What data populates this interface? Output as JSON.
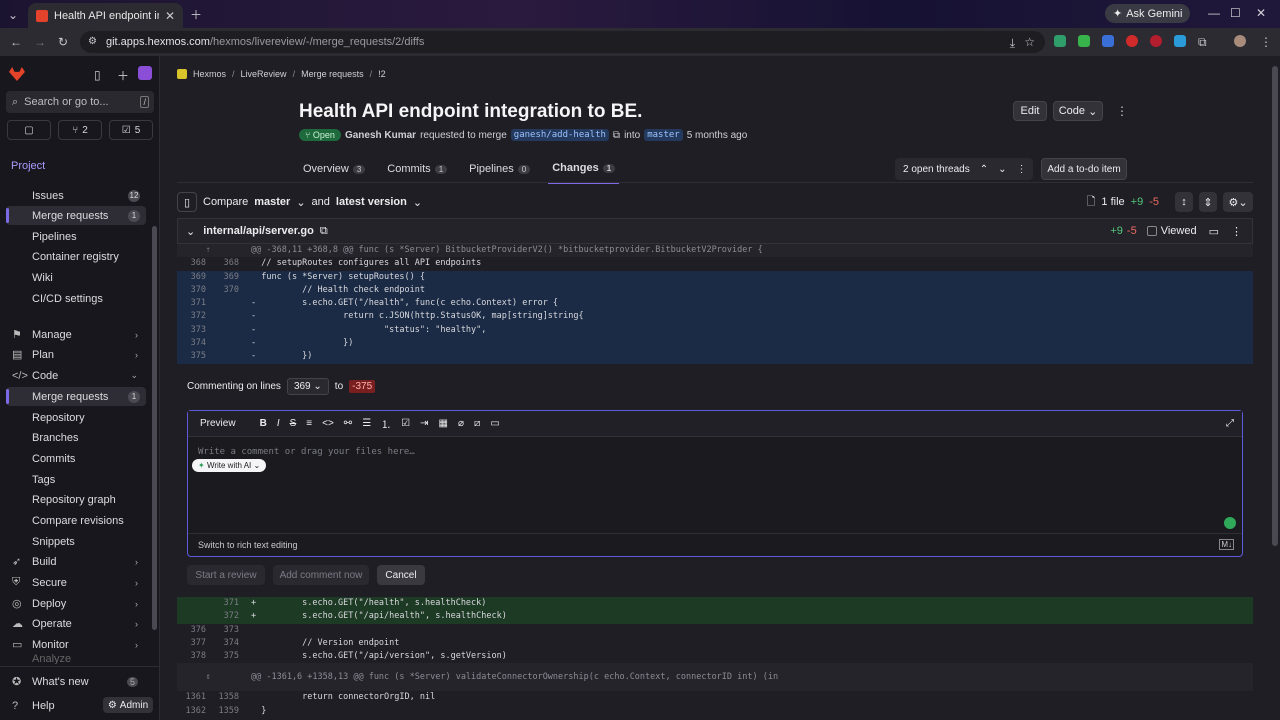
{
  "browser": {
    "tab_title": "Health API endpoint integratio",
    "url_host": "git.apps.hexmos.com",
    "url_path": "/hexmos/livereview/-/merge_requests/2/diffs",
    "gemini_label": "Ask Gemini"
  },
  "sidebar": {
    "search_placeholder": "Search or go to...",
    "counters": [
      "2",
      "5"
    ],
    "project_label": "Project",
    "top_items": [
      {
        "label": "Issues",
        "badge": "12"
      },
      {
        "label": "Merge requests",
        "badge": "1"
      },
      {
        "label": "Pipelines"
      },
      {
        "label": "Container registry"
      },
      {
        "label": "Wiki"
      },
      {
        "label": "CI/CD settings"
      }
    ],
    "groups": [
      "Manage",
      "Plan",
      "Code"
    ],
    "code_items": [
      {
        "label": "Merge requests",
        "badge": "1"
      },
      {
        "label": "Repository"
      },
      {
        "label": "Branches"
      },
      {
        "label": "Commits"
      },
      {
        "label": "Tags"
      },
      {
        "label": "Repository graph"
      },
      {
        "label": "Compare revisions"
      },
      {
        "label": "Snippets"
      }
    ],
    "groups2": [
      "Build",
      "Secure",
      "Deploy",
      "Operate",
      "Monitor"
    ],
    "analyze": "Analyze",
    "whats_new": "What's new",
    "whats_new_count": "5",
    "help": "Help",
    "admin": "Admin"
  },
  "breadcrumb": [
    "Hexmos",
    "LiveReview",
    "Merge requests",
    "!2"
  ],
  "mr": {
    "title": "Health API endpoint integration to BE.",
    "status": "Open",
    "author": "Ganesh Kumar",
    "requested": "requested to merge",
    "source_branch": "ganesh/add-health",
    "into": "into",
    "target_branch": "master",
    "time": "5 months ago",
    "edit": "Edit",
    "code": "Code"
  },
  "tabs": [
    {
      "label": "Overview",
      "count": "3"
    },
    {
      "label": "Commits",
      "count": "1"
    },
    {
      "label": "Pipelines",
      "count": "0"
    },
    {
      "label": "Changes",
      "count": "1"
    }
  ],
  "threads": {
    "label": "2 open threads",
    "todo": "Add a to-do item"
  },
  "compare": {
    "label": "Compare",
    "base": "master",
    "and": "and",
    "version": "latest version",
    "files": "1 file",
    "added": "+9",
    "removed": "-5"
  },
  "file": {
    "path": "internal/api/server.go",
    "added": "+9",
    "removed": "-5",
    "viewed": "Viewed"
  },
  "diff": {
    "hunk1": "@@ -368,11 +368,8 @@ func (s *Server) BitbucketProviderV2() *bitbucketprovider.BitbucketV2Provider {",
    "lines_top": [
      {
        "old": "368",
        "new": "368",
        "text": "  // setupRoutes configures all API endpoints",
        "type": "plain"
      },
      {
        "old": "369",
        "new": "369",
        "text": "  func (s *Server) setupRoutes() {",
        "type": "sel"
      },
      {
        "old": "370",
        "new": "370",
        "text": "          // Health check endpoint",
        "type": "sel"
      },
      {
        "old": "371",
        "new": "",
        "text": "-         s.echo.GET(\"/health\", func(c echo.Context) error {",
        "type": "sel"
      },
      {
        "old": "372",
        "new": "",
        "text": "-                 return c.JSON(http.StatusOK, map[string]string{",
        "type": "sel"
      },
      {
        "old": "373",
        "new": "",
        "text": "-                         \"status\": \"healthy\",",
        "type": "sel"
      },
      {
        "old": "374",
        "new": "",
        "text": "-                 })",
        "type": "sel"
      },
      {
        "old": "375",
        "new": "",
        "text": "-         })",
        "type": "sel"
      }
    ],
    "lines_bottom": [
      {
        "old": "",
        "new": "371",
        "text": "+         s.echo.GET(\"/health\", s.healthCheck)",
        "type": "add"
      },
      {
        "old": "",
        "new": "372",
        "text": "+         s.echo.GET(\"/api/health\", s.healthCheck)",
        "type": "add"
      },
      {
        "old": "376",
        "new": "373",
        "text": "",
        "type": "plain"
      },
      {
        "old": "377",
        "new": "374",
        "text": "          // Version endpoint",
        "type": "plain"
      },
      {
        "old": "378",
        "new": "375",
        "text": "          s.echo.GET(\"/api/version\", s.getVersion)",
        "type": "plain"
      }
    ],
    "hunk2": "@@ -1361,6 +1358,13 @@ func (s *Server) validateConnectorOwnership(c echo.Context, connectorID int) (in",
    "lines_end": [
      {
        "old": "1361",
        "new": "1358",
        "text": "          return connectorOrgID, nil",
        "type": "plain"
      },
      {
        "old": "1362",
        "new": "1359",
        "text": "  }",
        "type": "plain"
      }
    ]
  },
  "comment": {
    "on_lines": "Commenting on lines",
    "from": "369",
    "to": "to",
    "to_line": "-375",
    "preview": "Preview",
    "placeholder": "Write a comment or drag your files here…",
    "write_ai": "Write with AI",
    "switch": "Switch to rich text editing",
    "start_review": "Start a review",
    "add_now": "Add comment now",
    "cancel": "Cancel"
  }
}
